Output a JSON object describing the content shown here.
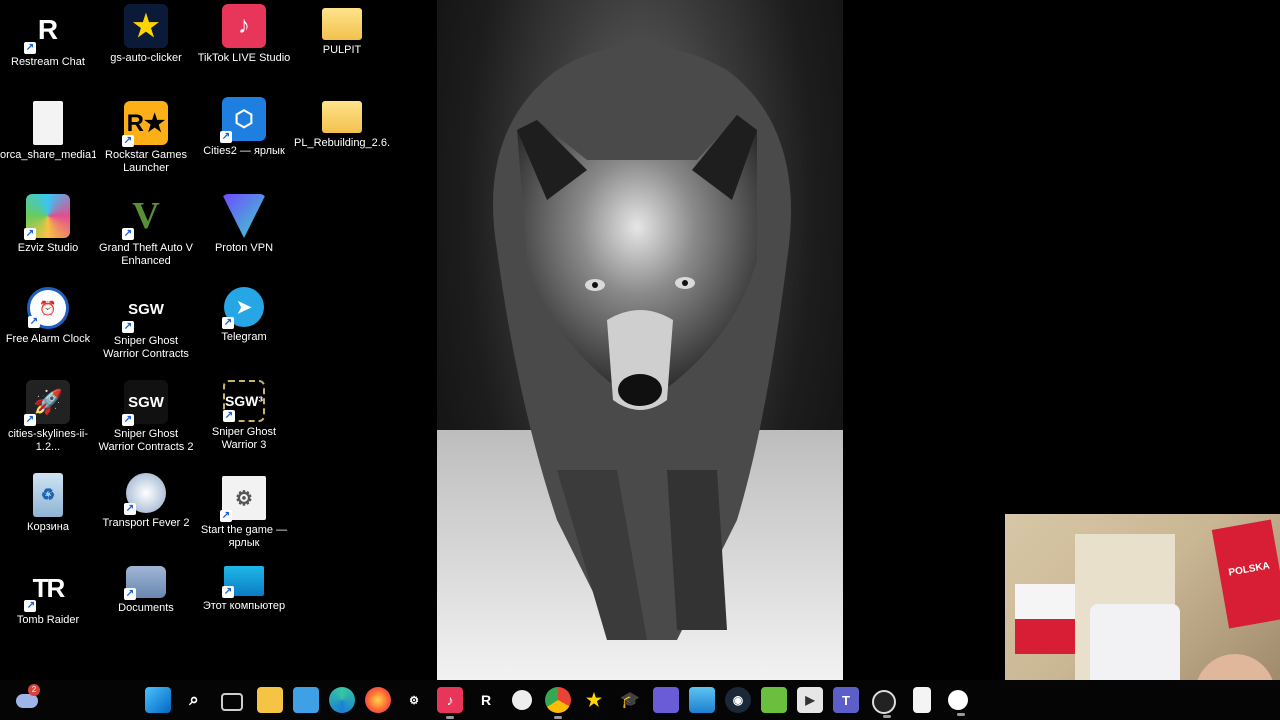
{
  "desktop": {
    "icons": [
      {
        "label": "Restream Chat",
        "icon": "restream-icon"
      },
      {
        "label": "gs-auto-clicker",
        "icon": "star-icon"
      },
      {
        "label": "TikTok LIVE Studio",
        "icon": "tiktok-icon"
      },
      {
        "label": "PULPIT",
        "icon": "folder-icon"
      },
      {
        "label": "orca_share_media1...",
        "icon": "file-icon"
      },
      {
        "label": "Rockstar Games Launcher",
        "icon": "rockstar-icon"
      },
      {
        "label": "Cities2 — ярлык",
        "icon": "cities2-icon"
      },
      {
        "label": "PL_Rebuilding_2.6.3...",
        "icon": "folder-icon"
      },
      {
        "label": "Ezviz Studio",
        "icon": "ezviz-icon"
      },
      {
        "label": "Grand Theft Auto V Enhanced",
        "icon": "gta-icon"
      },
      {
        "label": "Proton VPN",
        "icon": "protonvpn-icon"
      },
      {
        "label": "Free Alarm Clock",
        "icon": "clock-icon"
      },
      {
        "label": "Sniper Ghost Warrior Contracts",
        "icon": "sgw-icon"
      },
      {
        "label": "Telegram",
        "icon": "telegram-icon"
      },
      {
        "label": "cities-skylines-ii-1.2...",
        "icon": "rocket-icon"
      },
      {
        "label": "Sniper Ghost Warrior Contracts 2",
        "icon": "sgw2-icon"
      },
      {
        "label": "Sniper Ghost Warrior 3",
        "icon": "sgw3-icon"
      },
      {
        "label": "Корзина",
        "icon": "recycle-bin-icon"
      },
      {
        "label": "Transport Fever 2",
        "icon": "transport-fever-icon"
      },
      {
        "label": "Start the game — ярлык",
        "icon": "gears-icon"
      },
      {
        "label": "Tomb Raider",
        "icon": "tomb-raider-icon"
      },
      {
        "label": "Documents",
        "icon": "documents-folder-icon"
      },
      {
        "label": "Этот компьютер",
        "icon": "monitor-icon"
      }
    ],
    "wallpaper": "wolf-wallpaper",
    "webcam": "webcam-overlay",
    "webcam_flag_text": "POLSKA"
  },
  "taskbar": {
    "weather_badge": "2",
    "items": [
      {
        "icon": "windows-start-icon"
      },
      {
        "icon": "search-icon"
      },
      {
        "icon": "task-view-icon"
      },
      {
        "icon": "file-explorer-icon"
      },
      {
        "icon": "control-panel-icon"
      },
      {
        "icon": "edge-icon"
      },
      {
        "icon": "firefox-icon"
      },
      {
        "icon": "app-icon"
      },
      {
        "icon": "tiktok-icon"
      },
      {
        "icon": "restream-icon"
      },
      {
        "icon": "app-icon"
      },
      {
        "icon": "chrome-icon"
      },
      {
        "icon": "star-icon"
      },
      {
        "icon": "graduation-cap-icon"
      },
      {
        "icon": "app-icon"
      },
      {
        "icon": "photos-icon"
      },
      {
        "icon": "steam-icon"
      },
      {
        "icon": "game-icon"
      },
      {
        "icon": "player-icon"
      },
      {
        "icon": "teams-icon"
      },
      {
        "icon": "obs-icon"
      },
      {
        "icon": "notepad-icon"
      },
      {
        "icon": "clock-icon"
      }
    ]
  },
  "colors": {
    "accent": "#0a7cff",
    "desktop_bg": "#000000"
  }
}
